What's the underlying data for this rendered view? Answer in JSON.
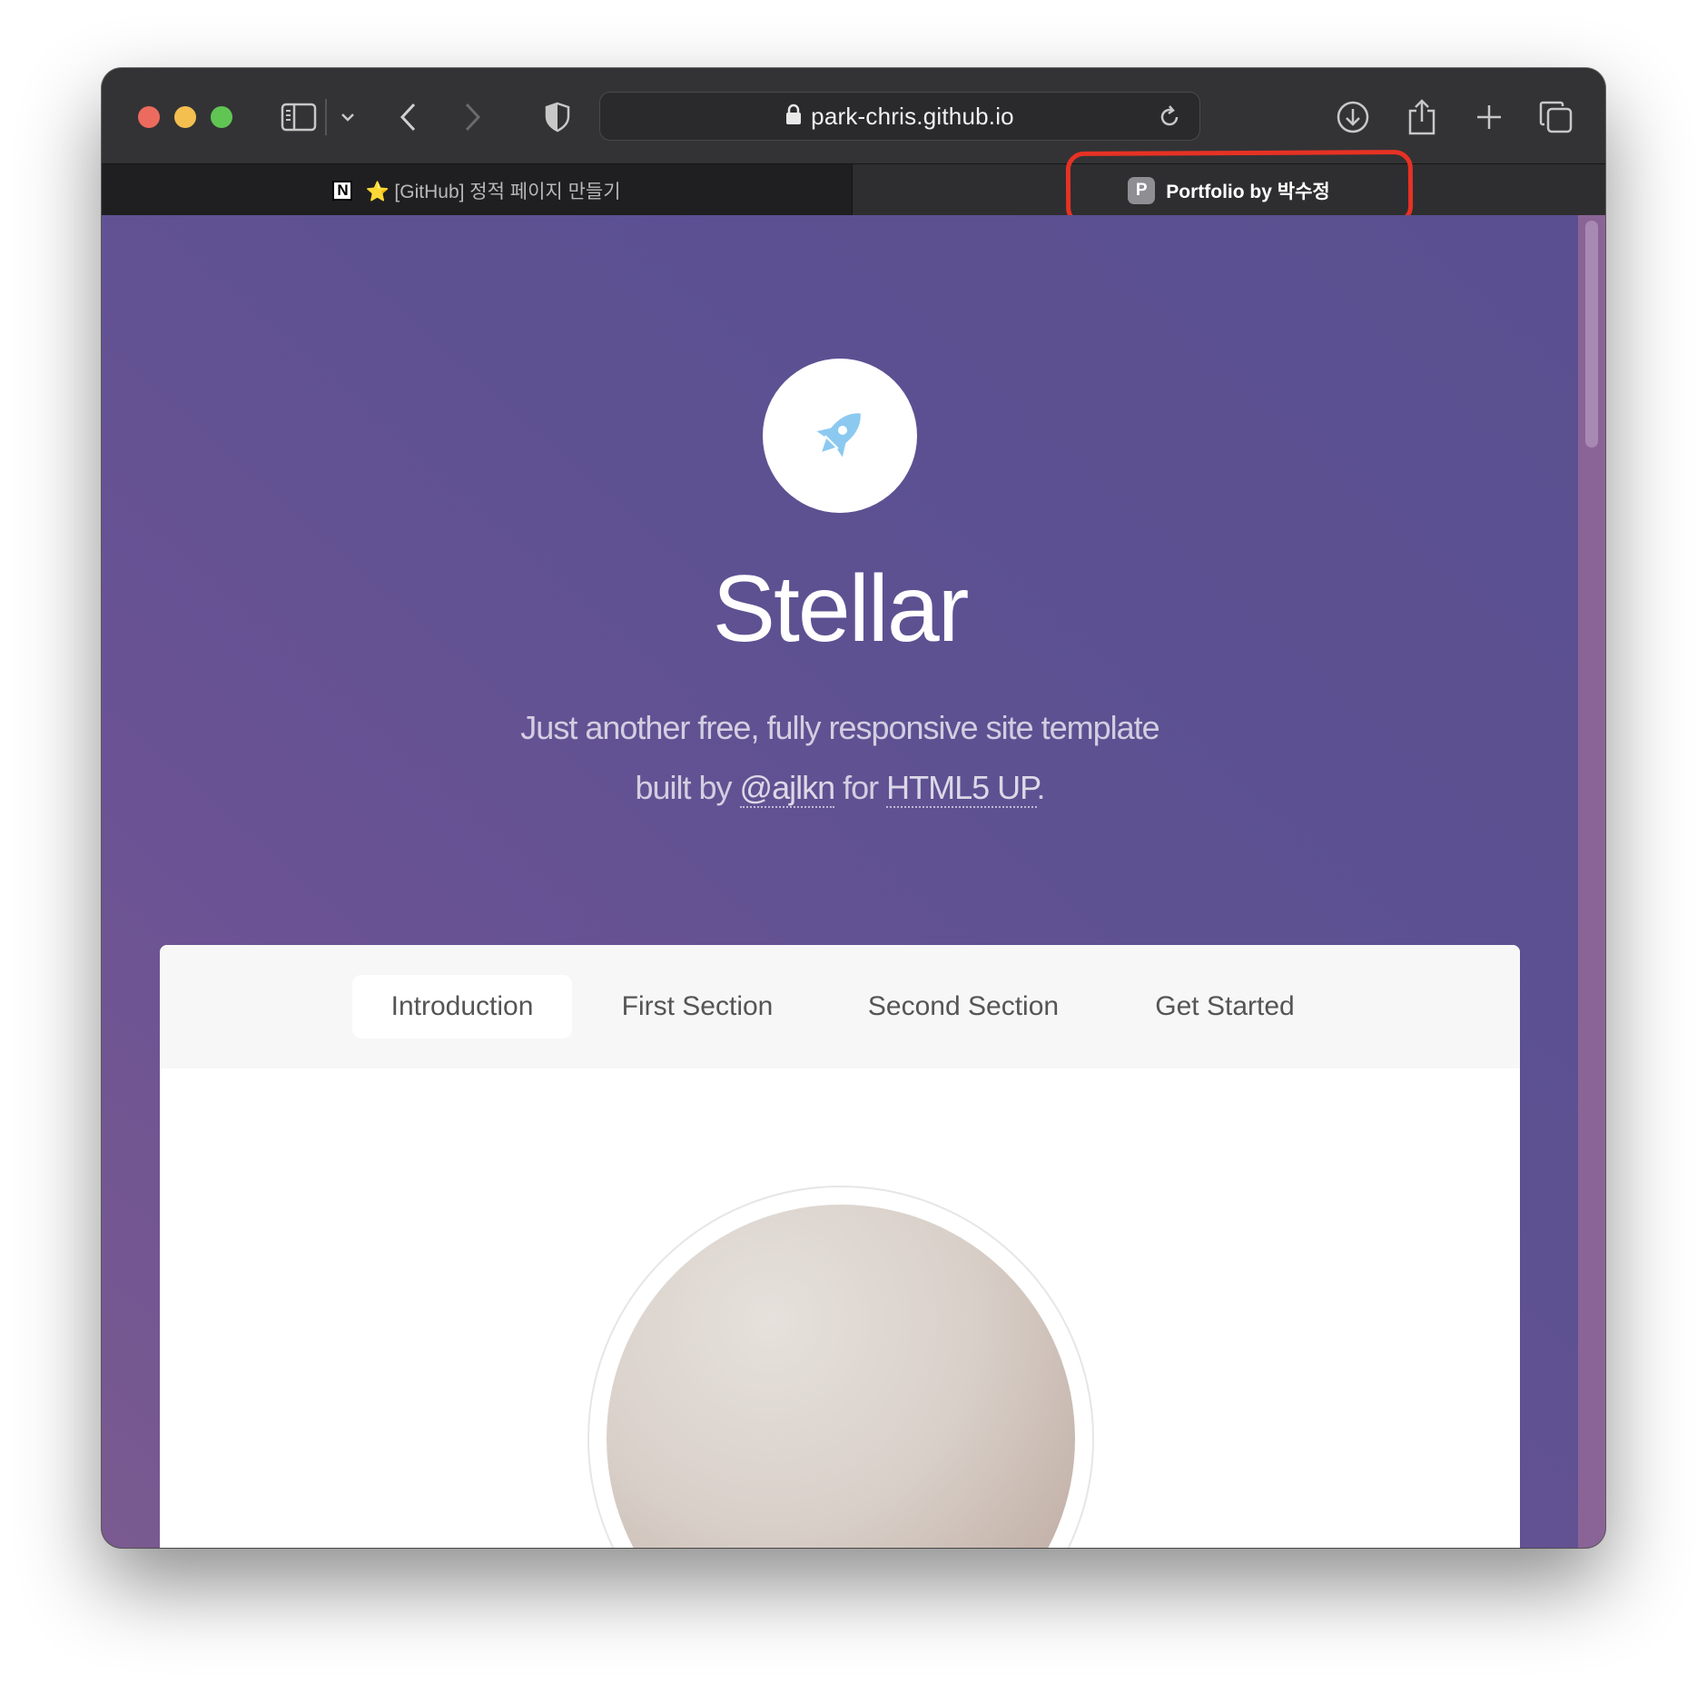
{
  "browser": {
    "url": "park-chris.github.io",
    "tabs": [
      {
        "title": "⭐ [GitHub] 정적 페이지 만들기",
        "favicon": "N",
        "active": false
      },
      {
        "title": "Portfolio by 박수정",
        "favicon": "P",
        "active": true
      }
    ]
  },
  "site": {
    "title": "Stellar",
    "tagline_line1": "Just another free, fully responsive site template",
    "tagline_prefix": "built by ",
    "author_link": "@ajlkn",
    "tagline_mid": " for ",
    "vendor_link": "HTML5 UP",
    "tagline_end": ".",
    "logo_icon": "rocket-icon",
    "colors": {
      "accent_purple": "#5d5192",
      "rocket_blue": "#8cc9f0",
      "annotation_red": "#e63224"
    }
  },
  "nav": {
    "items": [
      "Introduction",
      "First Section",
      "Second Section",
      "Get Started"
    ],
    "active_index": 0
  }
}
